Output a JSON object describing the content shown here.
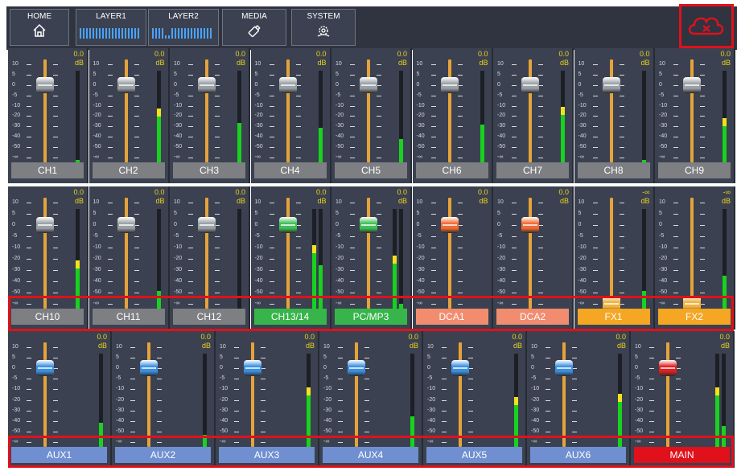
{
  "nav": {
    "tabs": [
      {
        "label": "HOME",
        "icon": "home-icon"
      },
      {
        "label": "LAYER1",
        "icon": "layer-bars-icon"
      },
      {
        "label": "LAYER2",
        "icon": "layer-bars-icon"
      },
      {
        "label": "MEDIA",
        "icon": "usb-drive-icon"
      },
      {
        "label": "SYSTEM",
        "icon": "settings-gear-icon"
      }
    ],
    "cloud": {
      "icon": "cloud-disconnected-icon",
      "status": "disconnected"
    }
  },
  "scale_labels": [
    "10",
    "5",
    "0",
    "-5",
    "-10",
    "-20",
    "-30",
    "-40",
    "-50",
    "-∞"
  ],
  "colors": {
    "gray": "#7d7f82",
    "green": "#38b54a",
    "salmon": "#f28c6f",
    "amber": "#f5a623",
    "blue_label": "#6f8fd0",
    "red_label": "#e0111b",
    "knob_gray": "#9aa0a6",
    "knob_green": "#3fbf56",
    "knob_orange": "#f26a33",
    "knob_amber": "#f0b240",
    "knob_blue": "#3b8fe0",
    "knob_red": "#e02020",
    "meter_green": "#19d11f",
    "meter_yellow": "#f2e21a"
  },
  "rows": [
    {
      "channels": [
        {
          "label": "CH1",
          "db": "0.0",
          "unit": "dB",
          "color": "gray",
          "knob": "knob_gray",
          "fader_db": 0,
          "meters": [
            0.06
          ]
        },
        {
          "label": "CH2",
          "db": "0.0",
          "unit": "dB",
          "color": "gray",
          "knob": "knob_gray",
          "fader_db": 0,
          "meters": [
            0.6
          ]
        },
        {
          "label": "CH3",
          "db": "0.0",
          "unit": "dB",
          "color": "gray",
          "knob": "knob_gray",
          "fader_db": 0,
          "meters": [
            0.45
          ]
        },
        {
          "label": "CH4",
          "db": "0.0",
          "unit": "dB",
          "color": "gray",
          "knob": "knob_gray",
          "fader_db": 0,
          "meters": [
            0.4
          ]
        },
        {
          "label": "CH5",
          "db": "0.0",
          "unit": "dB",
          "color": "gray",
          "knob": "knob_gray",
          "fader_db": 0,
          "meters": [
            0.28
          ]
        },
        {
          "label": "CH6",
          "db": "0.0",
          "unit": "dB",
          "color": "gray",
          "knob": "knob_gray",
          "fader_db": 0,
          "meters": [
            0.43
          ]
        },
        {
          "label": "CH7",
          "db": "0.0",
          "unit": "dB",
          "color": "gray",
          "knob": "knob_gray",
          "fader_db": 0,
          "meters": [
            0.62
          ]
        },
        {
          "label": "CH8",
          "db": "0.0",
          "unit": "dB",
          "color": "gray",
          "knob": "knob_gray",
          "fader_db": 0,
          "meters": [
            0.06
          ]
        },
        {
          "label": "CH9",
          "db": "0.0",
          "unit": "dB",
          "color": "gray",
          "knob": "knob_gray",
          "fader_db": 0,
          "meters": [
            0.5
          ]
        }
      ]
    },
    {
      "channels": [
        {
          "label": "CH10",
          "db": "0.0",
          "unit": "dB",
          "color": "gray",
          "knob": "knob_gray",
          "fader_db": 0,
          "meters": [
            0.5
          ]
        },
        {
          "label": "CH11",
          "db": "0.0",
          "unit": "dB",
          "color": "gray",
          "knob": "knob_gray",
          "fader_db": 0,
          "meters": [
            0.2
          ]
        },
        {
          "label": "CH12",
          "db": "0.0",
          "unit": "dB",
          "color": "gray",
          "knob": "knob_gray",
          "fader_db": 0,
          "meters": [
            0.0
          ]
        },
        {
          "label": "CH13/14",
          "db": "0.0",
          "unit": "dB",
          "color": "green",
          "knob": "knob_green",
          "fader_db": 0,
          "meters": [
            0.65,
            0.45
          ]
        },
        {
          "label": "PC/MP3",
          "db": "0.0",
          "unit": "dB",
          "color": "green",
          "knob": "knob_green",
          "fader_db": 0,
          "meters": [
            0.55,
            0.08
          ]
        },
        {
          "label": "DCA1",
          "db": "0.0",
          "unit": "dB",
          "color": "salmon",
          "knob": "knob_orange",
          "fader_db": 0,
          "meters": []
        },
        {
          "label": "DCA2",
          "db": "0.0",
          "unit": "dB",
          "color": "salmon",
          "knob": "knob_orange",
          "fader_db": 0,
          "meters": []
        },
        {
          "label": "FX1",
          "db": "-∞",
          "unit": "dB",
          "color": "amber",
          "knob": "knob_amber",
          "fader_db": -100,
          "meters": [
            0.2
          ]
        },
        {
          "label": "FX2",
          "db": "-∞",
          "unit": "dB",
          "color": "amber",
          "knob": "knob_amber",
          "fader_db": -100,
          "meters": [
            0.35
          ]
        }
      ]
    },
    {
      "channels": [
        {
          "label": "AUX1",
          "db": "0.0",
          "unit": "dB",
          "color": "blue_label",
          "knob": "knob_blue",
          "fader_db": 0,
          "meters": [
            0.28
          ]
        },
        {
          "label": "AUX2",
          "db": "0.0",
          "unit": "dB",
          "color": "blue_label",
          "knob": "knob_blue",
          "fader_db": 0,
          "meters": [
            0.16
          ]
        },
        {
          "label": "AUX3",
          "db": "0.0",
          "unit": "dB",
          "color": "blue_label",
          "knob": "knob_blue",
          "fader_db": 0,
          "meters": [
            0.65
          ]
        },
        {
          "label": "AUX4",
          "db": "0.0",
          "unit": "dB",
          "color": "blue_label",
          "knob": "knob_blue",
          "fader_db": 0,
          "meters": [
            0.35
          ]
        },
        {
          "label": "AUX5",
          "db": "0.0",
          "unit": "dB",
          "color": "blue_label",
          "knob": "knob_blue",
          "fader_db": 0,
          "meters": [
            0.55
          ]
        },
        {
          "label": "AUX6",
          "db": "0.0",
          "unit": "dB",
          "color": "blue_label",
          "knob": "knob_blue",
          "fader_db": 0,
          "meters": [
            0.58
          ]
        },
        {
          "label": "MAIN",
          "db": "0.0",
          "unit": "dB",
          "color": "red_label",
          "knob": "knob_red",
          "fader_db": 0,
          "meters": [
            0.65,
            0.25
          ]
        }
      ]
    }
  ]
}
